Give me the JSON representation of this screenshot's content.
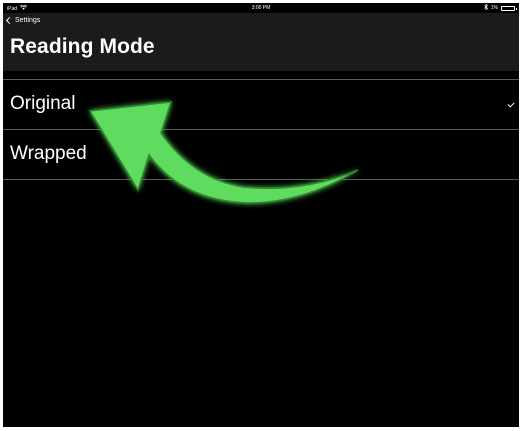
{
  "status_bar": {
    "device": "iPad",
    "time": "3:00 PM",
    "battery_text": "1%"
  },
  "nav": {
    "back_label": "Settings",
    "title": "Reading Mode"
  },
  "options": [
    {
      "label": "Original",
      "selected": true
    },
    {
      "label": "Wrapped",
      "selected": false
    }
  ],
  "icons": {
    "wifi": "wifi-icon",
    "bluetooth": "bluetooth-icon",
    "battery": "battery-icon",
    "back": "chevron-left-icon",
    "check": "checkmark-icon",
    "annotation": "curved-arrow-icon"
  },
  "colors": {
    "background": "#000000",
    "nav_background": "#1b1b1b",
    "separator": "#5a5a5a",
    "text": "#ffffff",
    "annotation_arrow": "#5fdc5f"
  }
}
